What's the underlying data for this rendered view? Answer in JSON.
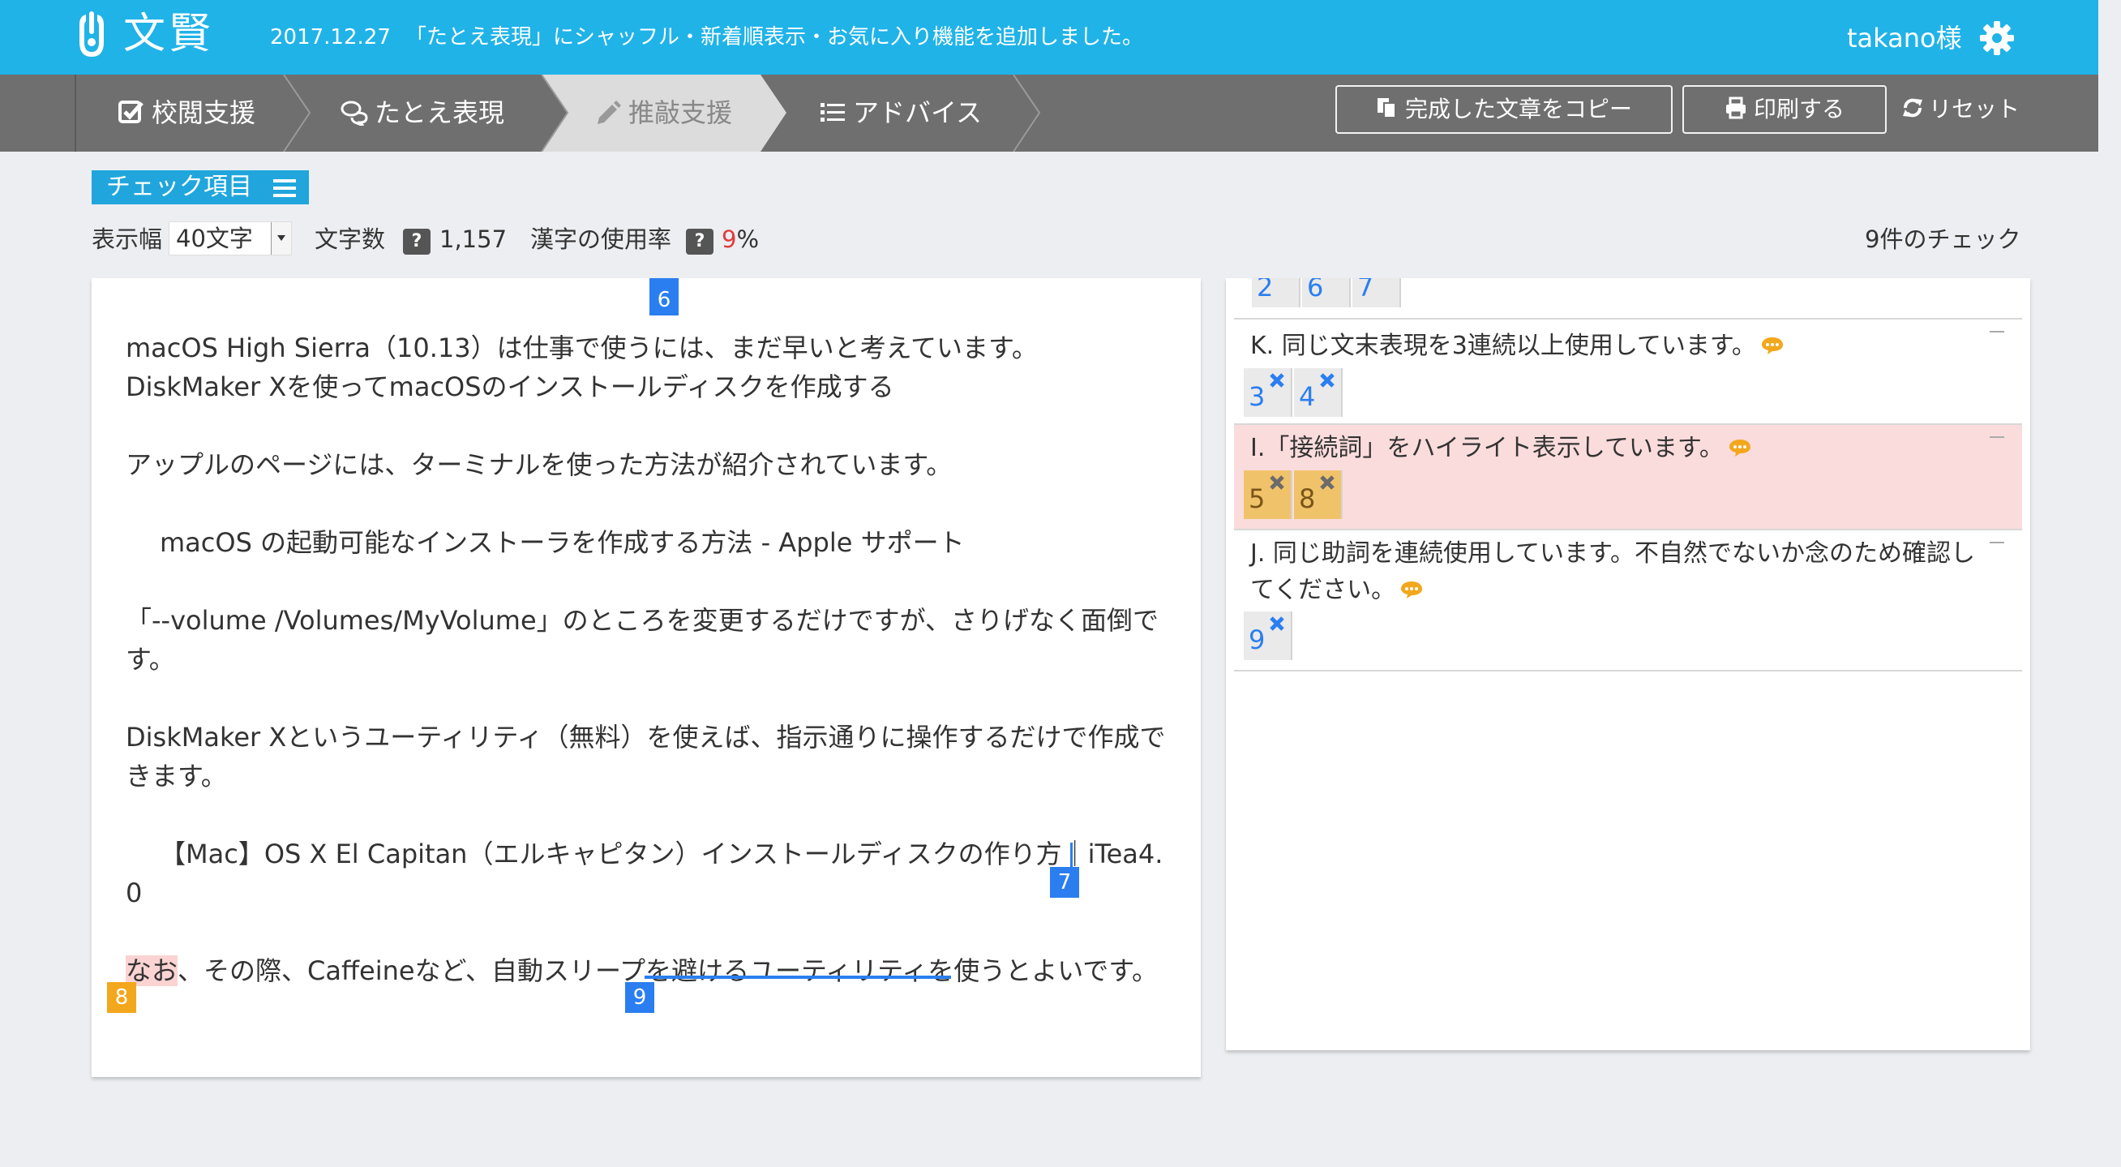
{
  "header": {
    "brand": "文賢",
    "announcement_date": "2017.12.27",
    "announcement_text": "「たとえ表現」にシャッフル・新着順表示・お気に入り機能を追加しました。",
    "user": "takano様",
    "accent_color": "#20b3e8"
  },
  "nav": {
    "tabs": [
      {
        "label": "校閲支援",
        "icon": "check-square-icon"
      },
      {
        "label": "たとえ表現",
        "icon": "comments-icon"
      },
      {
        "label": "推敲支援",
        "icon": "pencil-icon",
        "active": true
      },
      {
        "label": "アドバイス",
        "icon": "list-icon"
      }
    ],
    "copy_button": "完成した文章をコピー",
    "print_button": "印刷する",
    "reset_button": "リセット"
  },
  "toolbar": {
    "check_items_label": "チェック項目",
    "display_width_label": "表示幅",
    "display_width_value": "40文字",
    "char_count_label": "文字数",
    "char_count_value": "1,157",
    "kanji_rate_label": "漢字の使用率",
    "kanji_rate_value": "9",
    "kanji_rate_unit": "%",
    "help_symbol": "?",
    "check_count": "9件のチェック"
  },
  "editor": {
    "lines": [
      "macOS High Sierra（10.13）は仕事で使うには、まだ早いと考えています。",
      "DiskMaker Xを使ってmacOSのインストールディスクを作成する",
      "アップルのページには、ターミナルを使った方法が紹介されています。",
      "macOS の起動可能なインストーラを作成する方法 - Apple サポート",
      "「--volume /Volumes/MyVolume」のところを変更するだけですが、さりげなく面倒で",
      "す。",
      "DiskMaker Xというユーティリティ（無料）を使えば、指示通りに操作するだけで作成で",
      "きます。",
      "【Mac】OS X El Capitan（エルキャピタン）インストールディスクの作り方｜iTea4.",
      "0"
    ],
    "last_line": {
      "highlight": "なお",
      "part1": "、その際、Caffeineなど、自動スリープ",
      "underline": "を避けるユーティリティを",
      "part2": "使うとよいです。"
    },
    "markers": [
      "6",
      "7",
      "8",
      "9"
    ]
  },
  "checks": {
    "top_partial_tags": [
      "2",
      "6",
      "7"
    ],
    "items": [
      {
        "text": "K. 同じ文末表現を3連続以上使用しています。",
        "tags": [
          "3",
          "4"
        ]
      },
      {
        "text": "I.「接続詞」をハイライト表示しています。",
        "tags": [
          "5",
          "8"
        ],
        "highlighted": true
      },
      {
        "text": "J. 同じ助詞を連続使用しています。不自然でないか念のため確認してください。",
        "tags": [
          "9"
        ]
      }
    ]
  }
}
